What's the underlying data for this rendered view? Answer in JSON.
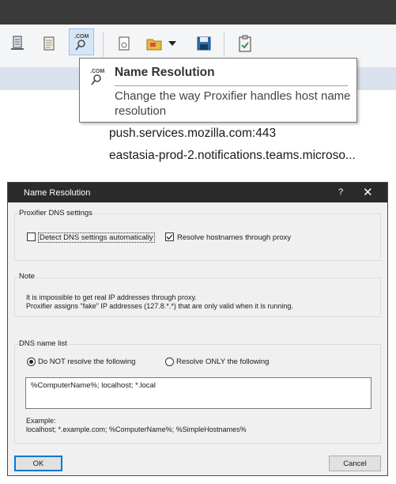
{
  "toolbar": {
    "icons": [
      "server-icon",
      "log-icon",
      "name-resolution-icon",
      "page-icon",
      "open-folder-icon",
      "dropdown-arrow-icon",
      "save-icon",
      "clipboard-icon"
    ],
    "com_label": ".COM",
    "accent": "#9cc2e6"
  },
  "tooltip": {
    "title": "Name Resolution",
    "description": "Change the way Proxifier handles host name resolution",
    "icon_label": ".COM"
  },
  "connections": [
    "push.services.mozilla.com:443",
    "eastasia-prod-2.notifications.teams.microso..."
  ],
  "dialog": {
    "title": "Name Resolution",
    "help": "?",
    "close": "✕",
    "dns_settings": {
      "label": "Proxifier DNS settings",
      "detect_label": "Detect DNS settings automatically",
      "detect_checked": false,
      "resolve_label": "Resolve hostnames through proxy",
      "resolve_checked": true
    },
    "note": {
      "label": "Note",
      "line1": "It is impossible to get real IP addresses through proxy.",
      "line2": "Proxifier assigns \"fake\" IP addresses (127.8.*.*) that are only valid when it is running."
    },
    "dns_list": {
      "label": "DNS name list",
      "option_not": "Do NOT resolve the following",
      "option_only": "Resolve ONLY the following",
      "selected": "Do NOT resolve the following",
      "value": "%ComputerName%; localhost; *.local",
      "example_label": "Example:",
      "example_value": "localhost; *.example.com; %ComputerName%; %SimpleHostnames%"
    },
    "ok_label": "OK",
    "cancel_label": "Cancel"
  }
}
